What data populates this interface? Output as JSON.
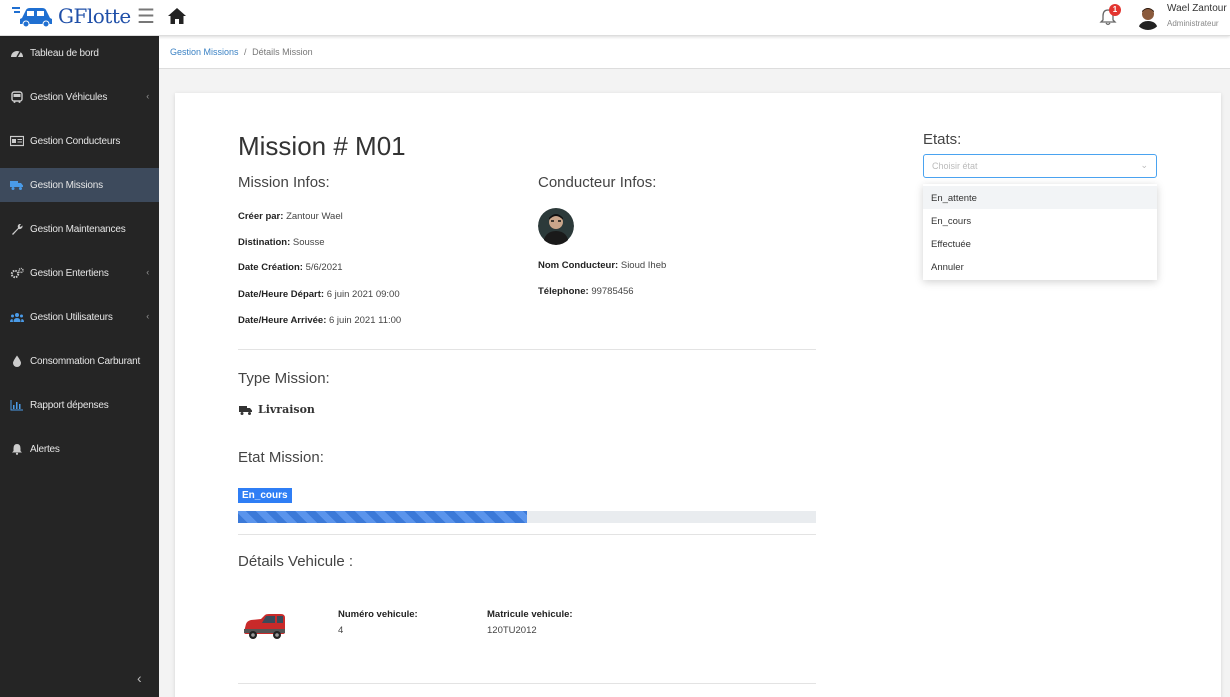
{
  "header": {
    "brand": "GFlotte",
    "notifications_count": "1",
    "user_name": "Wael Zantour",
    "user_role": "Administrateur"
  },
  "sidebar": {
    "items": [
      {
        "label": "Tableau de bord",
        "icon": "dashboard-icon",
        "has_submenu": false,
        "active": false
      },
      {
        "label": "Gestion Véhicules",
        "icon": "bus-icon",
        "has_submenu": true,
        "active": false
      },
      {
        "label": "Gestion Conducteurs",
        "icon": "id-card-icon",
        "has_submenu": false,
        "active": false
      },
      {
        "label": "Gestion Missions",
        "icon": "truck-icon",
        "has_submenu": false,
        "active": true
      },
      {
        "label": "Gestion Maintenances",
        "icon": "wrench-icon",
        "has_submenu": false,
        "active": false
      },
      {
        "label": "Gestion Entertiens",
        "icon": "cogs-icon",
        "has_submenu": true,
        "active": false
      },
      {
        "label": "Gestion Utilisateurs",
        "icon": "users-icon",
        "has_submenu": true,
        "active": false
      },
      {
        "label": "Consommation Carburant",
        "icon": "drop-icon",
        "has_submenu": false,
        "active": false
      },
      {
        "label": "Rapport dépenses",
        "icon": "chart-icon",
        "has_submenu": false,
        "active": false
      },
      {
        "label": "Alertes",
        "icon": "bell-icon",
        "has_submenu": false,
        "active": false
      }
    ]
  },
  "breadcrumb": {
    "parent": "Gestion Missions",
    "separator": "/",
    "current": "Détails Mission"
  },
  "mission": {
    "title": "Mission # M01",
    "infos_title": "Mission Infos:",
    "created_by_label": "Créer par:",
    "created_by": "Zantour Wael",
    "destination_label": "Distination:",
    "destination": "Sousse",
    "creation_date_label": "Date Création:",
    "creation_date": "5/6/2021",
    "departure_label": "Date/Heure Départ:",
    "departure": "6 juin 2021 09:00",
    "arrival_label": "Date/Heure Arrivée:",
    "arrival": "6 juin 2021 11:00"
  },
  "driver": {
    "title": "Conducteur Infos:",
    "name_label": "Nom Conducteur:",
    "name": "Sioud Iheb",
    "phone_label": "Télephone:",
    "phone": "99785456"
  },
  "type": {
    "title": "Type Mission:",
    "value": "Livraison"
  },
  "state": {
    "title": "Etat Mission:",
    "badge": "En_cours",
    "progress": 0.5
  },
  "vehicle": {
    "title": "Détails Vehicule :",
    "number_label": "Numéro vehicule:",
    "number": "4",
    "plate_label": "Matricule vehicule:",
    "plate": "120TU2012"
  },
  "etats": {
    "title": "Etats:",
    "placeholder": "Choisir état",
    "options": [
      "En_attente",
      "En_cours",
      "Effectuée",
      "Annuler"
    ]
  },
  "colors": {
    "brand": "#1f4fa8",
    "sidebar_bg": "#252525",
    "sidebar_active": "#3d4a5c",
    "badge": "#2f7ef5",
    "notification": "#e3342f"
  }
}
